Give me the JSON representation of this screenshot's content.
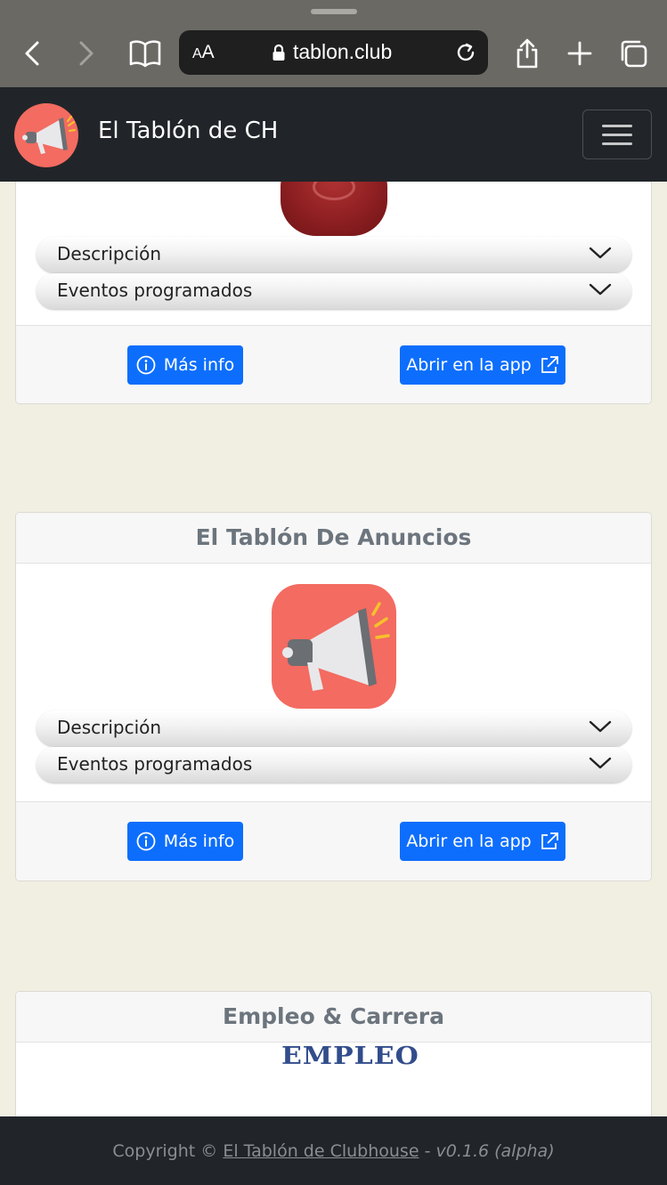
{
  "browser": {
    "text_size_label_small": "A",
    "text_size_label_big": "A",
    "url": "tablon.club"
  },
  "navbar": {
    "brand": "El Tablón de CH"
  },
  "cards": [
    {
      "accordion": [
        "Descripción",
        "Eventos programados"
      ],
      "more_info": "Más info",
      "open_app": "Abrir en la app"
    },
    {
      "title": "El Tablón De Anuncios",
      "accordion": [
        "Descripción",
        "Eventos programados"
      ],
      "more_info": "Más info",
      "open_app": "Abrir en la app"
    },
    {
      "title": "Empleo & Carrera",
      "image_text": "EMPLEO"
    }
  ],
  "footer": {
    "prefix": "Copyright ©",
    "link": "El Tablón de Clubhouse",
    "separator": "-",
    "version": "v0.1.6 (alpha)"
  },
  "colors": {
    "primary": "#0d6efd",
    "navbar": "#212529",
    "page_bg": "#f1eee2",
    "logo_bg": "#f36b61"
  }
}
